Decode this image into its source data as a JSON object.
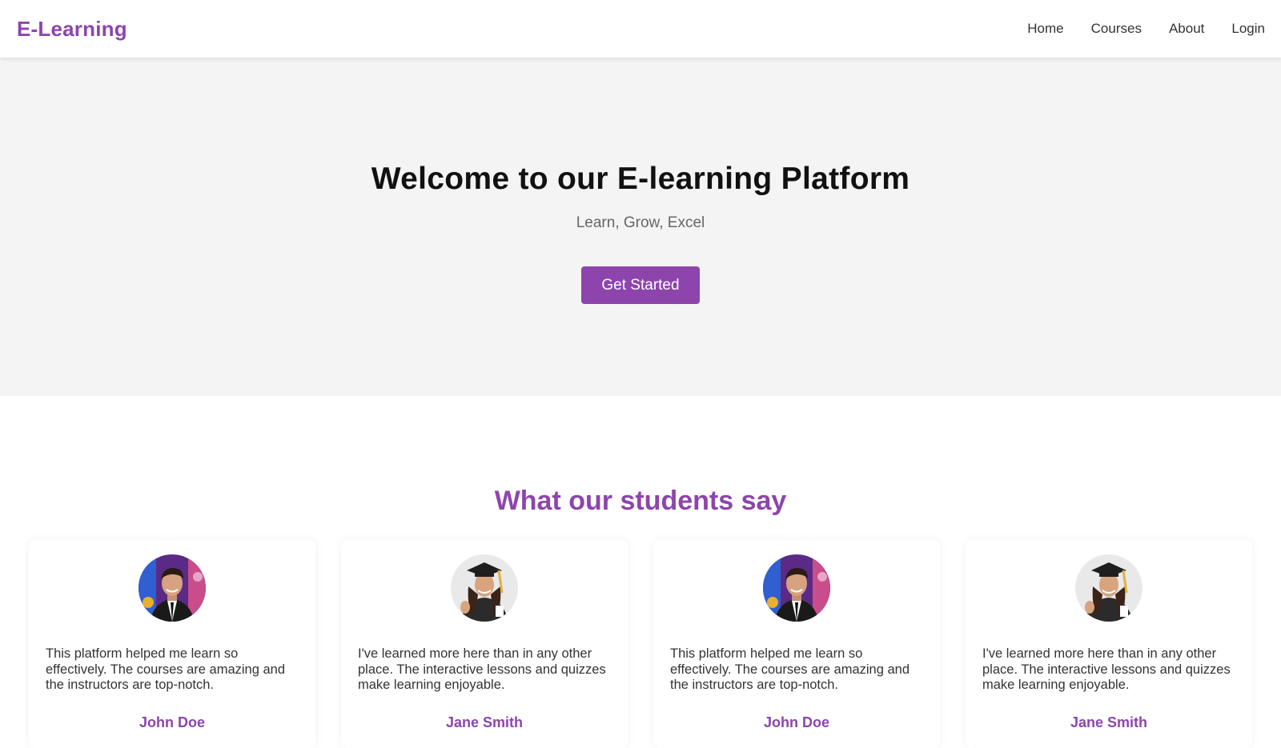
{
  "navbar": {
    "logo": "E-Learning",
    "links": [
      "Home",
      "Courses",
      "About",
      "Login"
    ]
  },
  "hero": {
    "title": "Welcome to our E-learning Platform",
    "subtitle": "Learn, Grow, Excel",
    "cta_label": "Get Started"
  },
  "testimonials": {
    "title": "What our students say",
    "items": [
      {
        "avatar": "male-student-avatar",
        "quote": "This platform helped me learn so effectively. The courses are amazing and the instructors are top-notch.",
        "name": "John Doe"
      },
      {
        "avatar": "female-graduate-avatar",
        "quote": "I've learned more here than in any other place. The interactive lessons and quizzes make learning enjoyable.",
        "name": "Jane Smith"
      },
      {
        "avatar": "male-student-avatar",
        "quote": "This platform helped me learn so effectively. The courses are amazing and the instructors are top-notch.",
        "name": "John Doe"
      },
      {
        "avatar": "female-graduate-avatar",
        "quote": "I've learned more here than in any other place. The interactive lessons and quizzes make learning enjoyable.",
        "name": "Jane Smith"
      }
    ]
  },
  "colors": {
    "accent": "#8e44ad",
    "hero_background": "#f4f4f4",
    "text": "#333333"
  }
}
